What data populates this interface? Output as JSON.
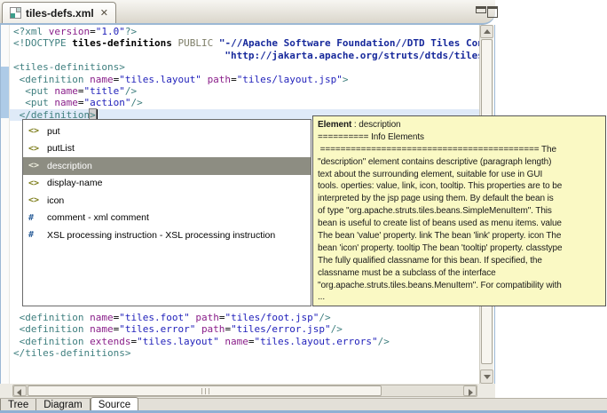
{
  "colors": {
    "c-tag": "#3f7f7f",
    "c-attr": "#8a1f8a",
    "c-val": "#2222bb",
    "c-kw": "#7e7e68",
    "c-str": "#16289b",
    "blue-border": "#9cb8d4",
    "range": "#aecbe7",
    "currentline": "#dfeaf8",
    "select": "#8d8d82",
    "doc-bg": "#faf9c4",
    "strip": "#8fb0d4"
  },
  "editor_tab": {
    "title": "tiles-defs.xml",
    "close": "✕"
  },
  "code": {
    "current_line": 7,
    "top_lines": [
      [
        [
          "t",
          "<?xml "
        ],
        [
          "a",
          "version"
        ],
        [
          "p",
          "="
        ],
        [
          "v",
          "\"1.0\""
        ],
        [
          "t",
          "?>"
        ]
      ],
      [
        [
          "t",
          "<!DOCTYPE "
        ],
        [
          "d",
          "tiles-definitions"
        ],
        [
          "p",
          " "
        ],
        [
          "k",
          "PUBLIC"
        ],
        [
          "p",
          " "
        ],
        [
          "s",
          "\"-//Apache Software Foundation//DTD Tiles Conf"
        ]
      ],
      [
        [
          "p",
          "                                    "
        ],
        [
          "s",
          "\"http://jakarta.apache.org/struts/dtds/tiles-c"
        ]
      ],
      [
        [
          "t",
          "<tiles-definitions>"
        ]
      ],
      [
        [
          "t",
          " <definition "
        ],
        [
          "a",
          "name"
        ],
        [
          "p",
          "="
        ],
        [
          "v",
          "\"tiles.layout\""
        ],
        [
          "p",
          " "
        ],
        [
          "a",
          "path"
        ],
        [
          "p",
          "="
        ],
        [
          "v",
          "\"tiles/layout.jsp\""
        ],
        [
          "t",
          ">"
        ]
      ],
      [
        [
          "t",
          "  <put "
        ],
        [
          "a",
          "name"
        ],
        [
          "p",
          "="
        ],
        [
          "v",
          "\"title\""
        ],
        [
          "t",
          "/>"
        ]
      ],
      [
        [
          "t",
          "  <put "
        ],
        [
          "a",
          "name"
        ],
        [
          "p",
          "="
        ],
        [
          "v",
          "\"action\""
        ],
        [
          "t",
          "/>"
        ]
      ],
      [
        [
          "t",
          " </definition"
        ],
        [
          "b",
          ">"
        ]
      ]
    ],
    "bottom_lines": [
      [
        [
          "t",
          " <definition "
        ],
        [
          "a",
          "name"
        ],
        [
          "p",
          "="
        ],
        [
          "v",
          "\"tiles.foot\""
        ],
        [
          "p",
          " "
        ],
        [
          "a",
          "path"
        ],
        [
          "p",
          "="
        ],
        [
          "v",
          "\"tiles/foot.jsp\""
        ],
        [
          "t",
          "/>"
        ]
      ],
      [
        [
          "t",
          " <definition "
        ],
        [
          "a",
          "name"
        ],
        [
          "p",
          "="
        ],
        [
          "v",
          "\"tiles.error\""
        ],
        [
          "p",
          " "
        ],
        [
          "a",
          "path"
        ],
        [
          "p",
          "="
        ],
        [
          "v",
          "\"tiles/error.jsp\""
        ],
        [
          "t",
          "/>"
        ]
      ],
      [
        [
          "t",
          " <definition "
        ],
        [
          "a",
          "extends"
        ],
        [
          "p",
          "="
        ],
        [
          "v",
          "\"tiles.layout\""
        ],
        [
          "p",
          " "
        ],
        [
          "a",
          "name"
        ],
        [
          "p",
          "="
        ],
        [
          "v",
          "\"tiles.layout.errors\""
        ],
        [
          "t",
          "/>"
        ]
      ],
      [
        [
          "t",
          "</tiles-definitions>"
        ]
      ]
    ]
  },
  "popup": {
    "glyphs": {
      "element": "<>",
      "instruction": "#"
    },
    "items": [
      {
        "icon": "element",
        "label": "put"
      },
      {
        "icon": "element",
        "label": "putList"
      },
      {
        "icon": "element",
        "label": "description",
        "selected": true
      },
      {
        "icon": "element",
        "label": "display-name"
      },
      {
        "icon": "element",
        "label": "icon"
      },
      {
        "icon": "instruction",
        "label": "comment - xml comment"
      },
      {
        "icon": "instruction",
        "label": "XSL processing instruction - XSL processing instruction"
      }
    ]
  },
  "doc": {
    "title_label": "Element",
    "title_rest": " : description",
    "lines": [
      "========== Info Elements",
      " =========================================== The",
      "\"description\" element contains descriptive (paragraph length)",
      "text about the surrounding element, suitable for use in GUI",
      "tools. operties: value, link, icon, tooltip. This properties are to be",
      "interpreted by the jsp page using them. By default the bean is",
      "of type \"org.apache.struts.tiles.beans.SimpleMenuItem\". This",
      "bean is useful to create list of beans used as menu items. value",
      "The bean 'value' property. link The bean 'link' property. icon The",
      "bean 'icon' property. tooltip The bean 'tooltip' property. classtype",
      "The fully qualified classname for this bean. If specified, the",
      "classname must be a subclass of the interface",
      "\"org.apache.struts.tiles.beans.MenuItem\". For compatibility with",
      "..."
    ]
  },
  "bottom_tabs": {
    "items": [
      {
        "label": "Tree"
      },
      {
        "label": "Diagram"
      },
      {
        "label": "Source",
        "active": true
      }
    ]
  }
}
